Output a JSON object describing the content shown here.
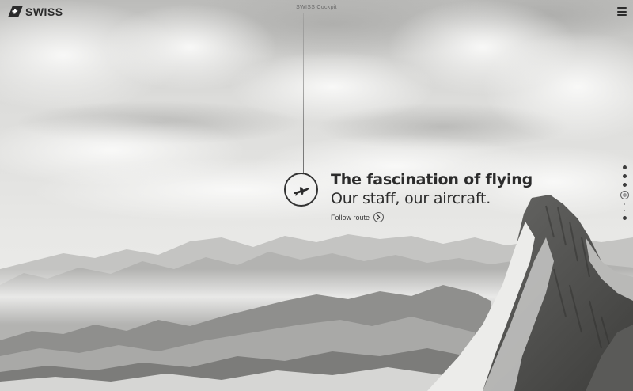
{
  "brand": {
    "logo_text": "SWISS",
    "logo_icon": "swiss-cross-icon"
  },
  "header": {
    "center_label": "SWISS Cockpit",
    "menu_icon": "hamburger-menu-icon"
  },
  "hero": {
    "badge_icon": "airplane-icon",
    "title": "The fascination of flying",
    "subtitle": "Our staff, our aircraft.",
    "cta_label": "Follow route",
    "cta_icon": "chevron-right-icon"
  },
  "section_nav": {
    "dots": [
      {
        "state": "default"
      },
      {
        "state": "default"
      },
      {
        "state": "default"
      },
      {
        "state": "active"
      },
      {
        "state": "faint"
      },
      {
        "state": "faint"
      },
      {
        "state": "default"
      }
    ]
  },
  "colors": {
    "text_dark": "#2c2c2c",
    "background": "#d9d9d7"
  }
}
